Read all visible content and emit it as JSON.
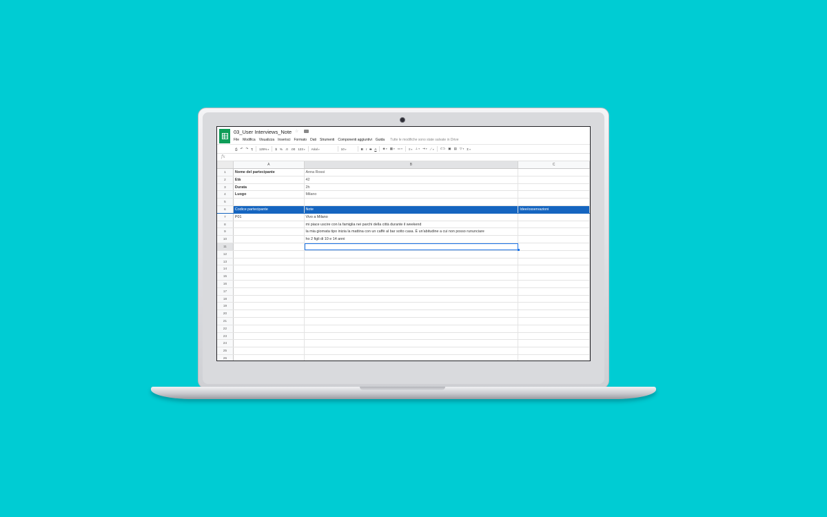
{
  "app": {
    "doc_title": "03_User Interviews_Note",
    "menu": [
      "File",
      "Modifica",
      "Visualizza",
      "Inserisci",
      "Formato",
      "Dati",
      "Strumenti",
      "Componenti aggiuntivi",
      "Guida"
    ],
    "saved_status": "Tutte le modifiche sono state salvate in Drive"
  },
  "toolbar": {
    "zoom": "125%",
    "currency": "$",
    "percent": "%",
    "decimals_less": ".0",
    "decimals_more": ".00",
    "number_format": "123",
    "font": "Arial",
    "font_size": "10",
    "bold": "B",
    "italic": "I",
    "strike": "S",
    "text_color": "A"
  },
  "formula_bar": {
    "fx_label": "fx"
  },
  "columns": [
    "A",
    "B",
    "C"
  ],
  "rows": [
    {
      "n": "1",
      "a": "Nome del partecipante",
      "b": "Anna Rossi",
      "c": ""
    },
    {
      "n": "2",
      "a": "Età",
      "b": "42",
      "c": ""
    },
    {
      "n": "3",
      "a": "Durata",
      "b": "2h",
      "c": ""
    },
    {
      "n": "4",
      "a": "Luogo",
      "b": "Milano",
      "c": ""
    },
    {
      "n": "5",
      "a": "",
      "b": "",
      "c": ""
    },
    {
      "n": "6",
      "a": "Codice partecipante",
      "b": "Note",
      "c": "Idee/osservazioni"
    },
    {
      "n": "7",
      "a": "P01",
      "b": "Vivo a Milano",
      "c": ""
    },
    {
      "n": "8",
      "a": "",
      "b": "mi piace uscire con la famiglia nei parchi della città durante il weekend",
      "c": ""
    },
    {
      "n": "9",
      "a": "",
      "b": "la mia giornata tipo inizia la mattina con un caffè al bar sotto casa. È un'abitudine a cui non posso rununciare",
      "c": ""
    },
    {
      "n": "10",
      "a": "",
      "b": "ho 2 figli di 10 e 14 anni",
      "c": ""
    },
    {
      "n": "11",
      "a": "",
      "b": "",
      "c": ""
    },
    {
      "n": "12",
      "a": "",
      "b": "",
      "c": ""
    },
    {
      "n": "13",
      "a": "",
      "b": "",
      "c": ""
    },
    {
      "n": "14",
      "a": "",
      "b": "",
      "c": ""
    },
    {
      "n": "15",
      "a": "",
      "b": "",
      "c": ""
    },
    {
      "n": "16",
      "a": "",
      "b": "",
      "c": ""
    },
    {
      "n": "17",
      "a": "",
      "b": "",
      "c": ""
    },
    {
      "n": "18",
      "a": "",
      "b": "",
      "c": ""
    },
    {
      "n": "19",
      "a": "",
      "b": "",
      "c": ""
    },
    {
      "n": "20",
      "a": "",
      "b": "",
      "c": ""
    },
    {
      "n": "21",
      "a": "",
      "b": "",
      "c": ""
    },
    {
      "n": "22",
      "a": "",
      "b": "",
      "c": ""
    },
    {
      "n": "23",
      "a": "",
      "b": "",
      "c": ""
    },
    {
      "n": "24",
      "a": "",
      "b": "",
      "c": ""
    },
    {
      "n": "25",
      "a": "",
      "b": "",
      "c": ""
    },
    {
      "n": "26",
      "a": "",
      "b": "",
      "c": ""
    }
  ],
  "selected_cell": "B11",
  "colors": {
    "background": "#00CCD3",
    "header_row": "#1565C0",
    "sheets_green": "#0F9D58",
    "selection": "#1a73e8"
  }
}
